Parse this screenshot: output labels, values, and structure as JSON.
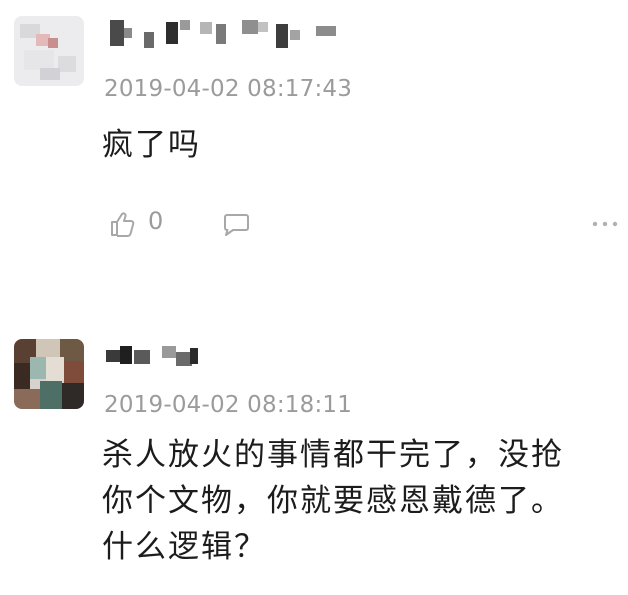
{
  "comments": [
    {
      "username": "",
      "timestamp": "2019-04-02 08:17:43",
      "text": [
        "疯了吗"
      ],
      "like_count": "0"
    },
    {
      "username": "",
      "timestamp": "2019-04-02 08:18:11",
      "text": [
        "杀人放火的事情都干完了，没抢",
        "你个文物，你就要感恩戴德了。",
        "什么逻辑？"
      ]
    }
  ],
  "icons": {
    "like": "thumbs-up-icon",
    "reply": "comment-bubble-icon",
    "more": "more-dots-icon"
  },
  "colors": {
    "timestamp": "#9b9b9b",
    "text": "#1c1c1c",
    "icon": "#a8a8a8"
  }
}
